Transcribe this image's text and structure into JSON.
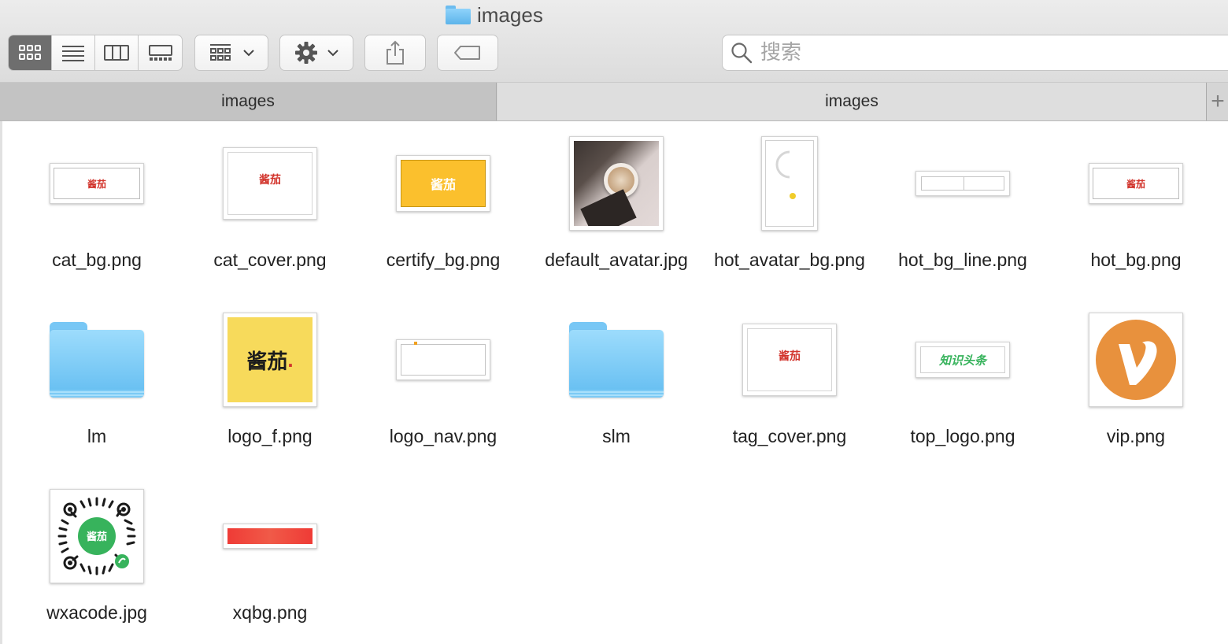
{
  "window": {
    "title": "images"
  },
  "toolbar": {
    "view_modes": [
      {
        "name": "view-icons-button",
        "icon": "icon-grid-icon",
        "active": true
      },
      {
        "name": "view-list-button",
        "icon": "list-icon",
        "active": false
      },
      {
        "name": "view-columns-button",
        "icon": "columns-icon",
        "active": false
      },
      {
        "name": "view-gallery-button",
        "icon": "gallery-icon",
        "active": false
      }
    ],
    "arrange_icon": "arrange-grid-icon",
    "action_icon": "gear-icon",
    "share_icon": "share-icon",
    "tags_icon": "tag-icon"
  },
  "search": {
    "placeholder": "搜索",
    "value": ""
  },
  "tabs": [
    {
      "label": "images",
      "active": false
    },
    {
      "label": "images",
      "active": true
    }
  ],
  "colors": {
    "accent_red": "#d2342c",
    "folder_blue": "#63bdf1",
    "vip_orange": "#e8913d",
    "wx_green": "#37b35c"
  },
  "files": [
    {
      "name": "cat_bg.png",
      "kind": "image",
      "preview_text": "酱茄"
    },
    {
      "name": "cat_cover.png",
      "kind": "image",
      "preview_text": "酱茄"
    },
    {
      "name": "certify_bg.png",
      "kind": "image",
      "preview_text": "酱茄"
    },
    {
      "name": "default_avatar.jpg",
      "kind": "photo",
      "preview_text": ""
    },
    {
      "name": "hot_avatar_bg.png",
      "kind": "image",
      "preview_text": ""
    },
    {
      "name": "hot_bg_line.png",
      "kind": "image",
      "preview_text": ""
    },
    {
      "name": "hot_bg.png",
      "kind": "image",
      "preview_text": "酱茄"
    },
    {
      "name": "lm",
      "kind": "folder",
      "preview_text": ""
    },
    {
      "name": "logo_f.png",
      "kind": "image",
      "preview_text": "酱茄"
    },
    {
      "name": "logo_nav.png",
      "kind": "image",
      "preview_text": ""
    },
    {
      "name": "slm",
      "kind": "folder",
      "preview_text": ""
    },
    {
      "name": "tag_cover.png",
      "kind": "image",
      "preview_text": "酱茄"
    },
    {
      "name": "top_logo.png",
      "kind": "image",
      "preview_text": "知识头条"
    },
    {
      "name": "vip.png",
      "kind": "image",
      "preview_text": ""
    },
    {
      "name": "wxacode.jpg",
      "kind": "qrcode",
      "preview_text": "酱茄"
    },
    {
      "name": "xqbg.png",
      "kind": "image",
      "preview_text": ""
    }
  ]
}
